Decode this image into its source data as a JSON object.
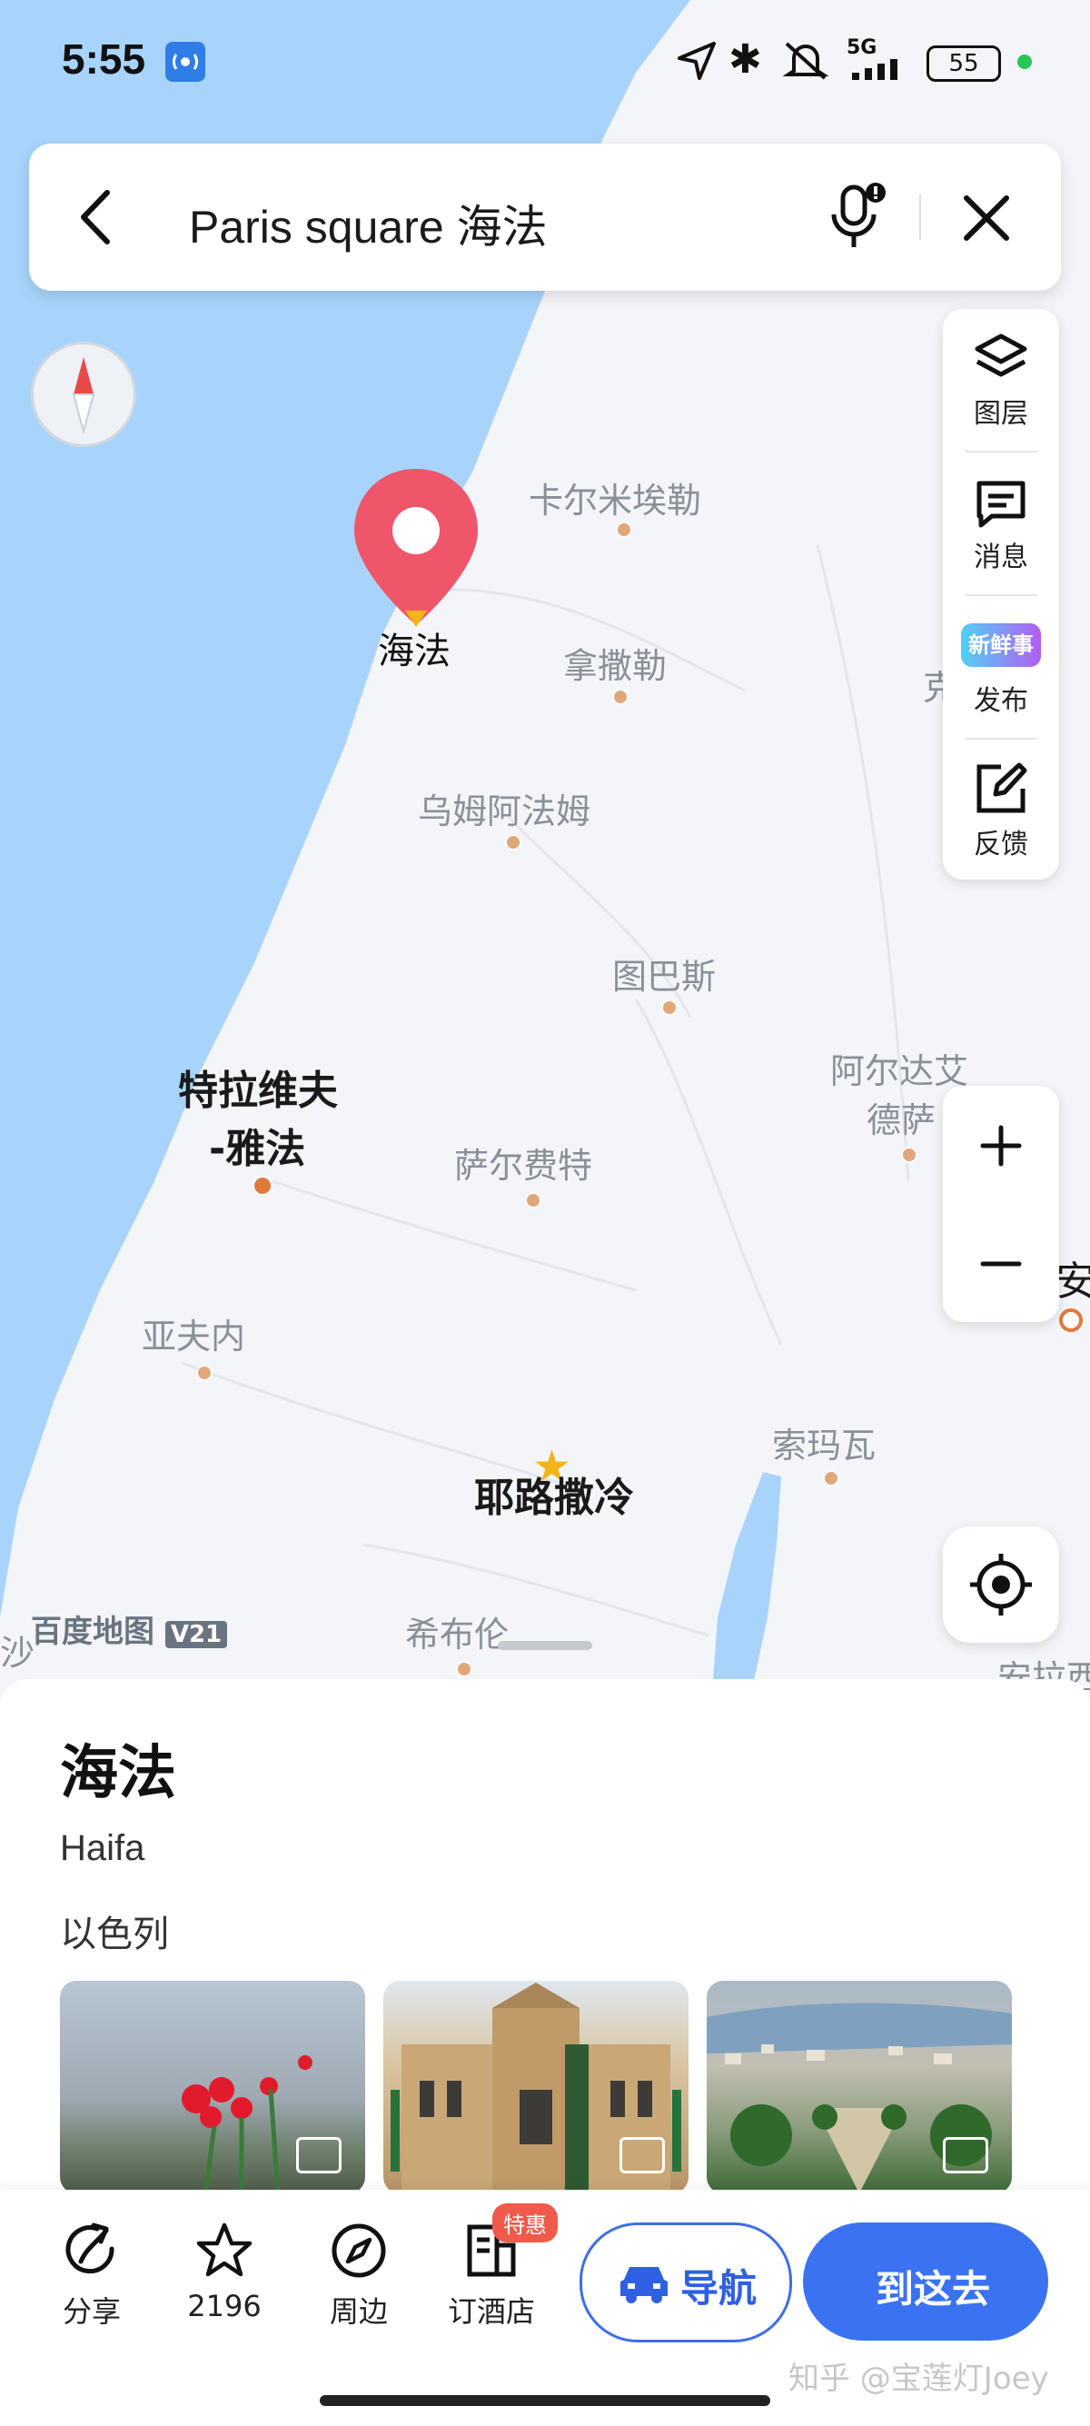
{
  "status_bar": {
    "time": "5:55",
    "network": "5G",
    "battery": "55"
  },
  "search": {
    "query": "Paris square 海法"
  },
  "tools": [
    {
      "label": "图层",
      "icon": "layers-icon"
    },
    {
      "label": "消息",
      "icon": "message-icon"
    },
    {
      "label": "发布",
      "icon": "publish-icon",
      "badge_text": "新鲜事"
    },
    {
      "label": "反馈",
      "icon": "feedback-icon"
    }
  ],
  "map": {
    "pin_label": "海法",
    "cities": [
      {
        "name": "卡尔米埃勒"
      },
      {
        "name": "拿撒勒"
      },
      {
        "name": "乌姆阿法姆"
      },
      {
        "name": "图巴斯"
      },
      {
        "name": "阿尔达艾"
      },
      {
        "name": "德萨"
      },
      {
        "name": "特拉维夫"
      },
      {
        "name": "-雅法"
      },
      {
        "name": "萨尔费特"
      },
      {
        "name": "亚夫内"
      },
      {
        "name": "耶路撒冷"
      },
      {
        "name": "索玛瓦"
      },
      {
        "name": "希布伦"
      },
      {
        "name": "安拉西"
      },
      {
        "name": "克"
      },
      {
        "name": "安曼"
      }
    ],
    "brand": "百度地图",
    "version": "V21",
    "edge_text": "沙"
  },
  "place": {
    "name": "海法",
    "english_name": "Haifa",
    "country": "以色列"
  },
  "actions": {
    "share": "分享",
    "favorites": "2196",
    "nearby": "周边",
    "hotel": "订酒店",
    "hotel_badge": "特惠",
    "navigate": "导航",
    "go_here": "到这去"
  },
  "watermark": "知乎 @宝莲灯Joey",
  "colors": {
    "sea": "#a8d4fb",
    "land": "#f3f5f8",
    "pin": "#f0566a",
    "accent": "#3a72f2"
  }
}
